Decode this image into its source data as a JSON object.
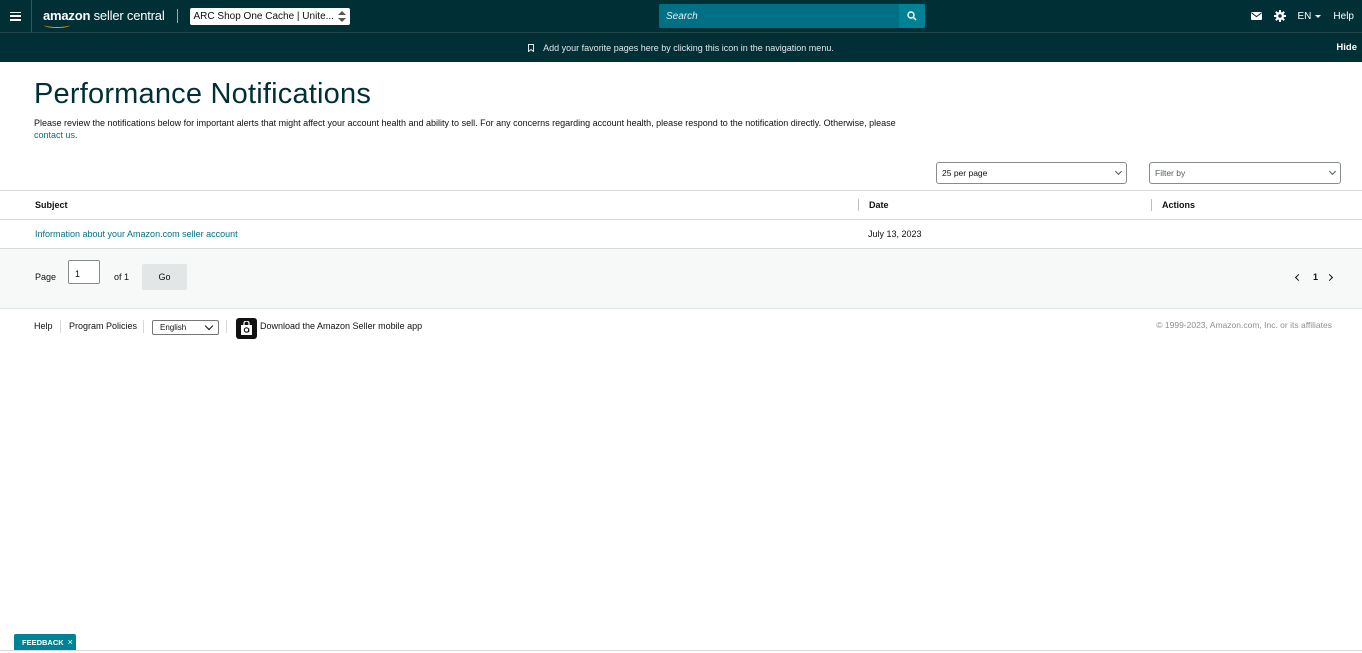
{
  "nav": {
    "logo_bold": "amazon",
    "logo_rest": " seller central",
    "account": "ARC Shop One Cache | Unite...",
    "search_placeholder": "Search",
    "language": "EN",
    "help": "Help"
  },
  "favorites_bar": {
    "message": "Add your favorite pages here by clicking this icon in the navigation menu.",
    "hide": "Hide"
  },
  "page": {
    "title": "Performance Notifications",
    "description": "Please review the notifications below for important alerts that might affect your account health and ability to sell. For any concerns regarding account health, please respond to the notification directly. Otherwise, please ",
    "contact_link": "contact us",
    "contact_suffix": "."
  },
  "filters": {
    "per_page": "25 per page",
    "filter_by": "Filter by"
  },
  "table": {
    "columns": [
      "Subject",
      "Date",
      "Actions"
    ],
    "rows": [
      {
        "subject": "Information about your Amazon.com seller account",
        "date": "July 13, 2023",
        "actions": ""
      }
    ]
  },
  "pagination": {
    "page_label": "Page",
    "current_page": "1",
    "of_label": "of 1",
    "go": "Go",
    "page_number": "1"
  },
  "footer": {
    "help": "Help",
    "program_policies": "Program Policies",
    "language": "English",
    "download_app": "Download the Amazon Seller mobile app",
    "copyright": "© 1999-2023, Amazon.com, Inc. or its affiliates"
  },
  "feedback": {
    "label": "FEEDBACK",
    "close": "×"
  },
  "colors": {
    "nav_bg": "#002f36",
    "search_bg": "#007185",
    "link": "#007185",
    "accent": "#ff9900"
  },
  "icons": [
    "menu-icon",
    "envelope-icon",
    "gear-icon",
    "search-icon",
    "bookmark-icon",
    "shopping-bag-icon",
    "chevron-left-icon",
    "chevron-right-icon"
  ]
}
